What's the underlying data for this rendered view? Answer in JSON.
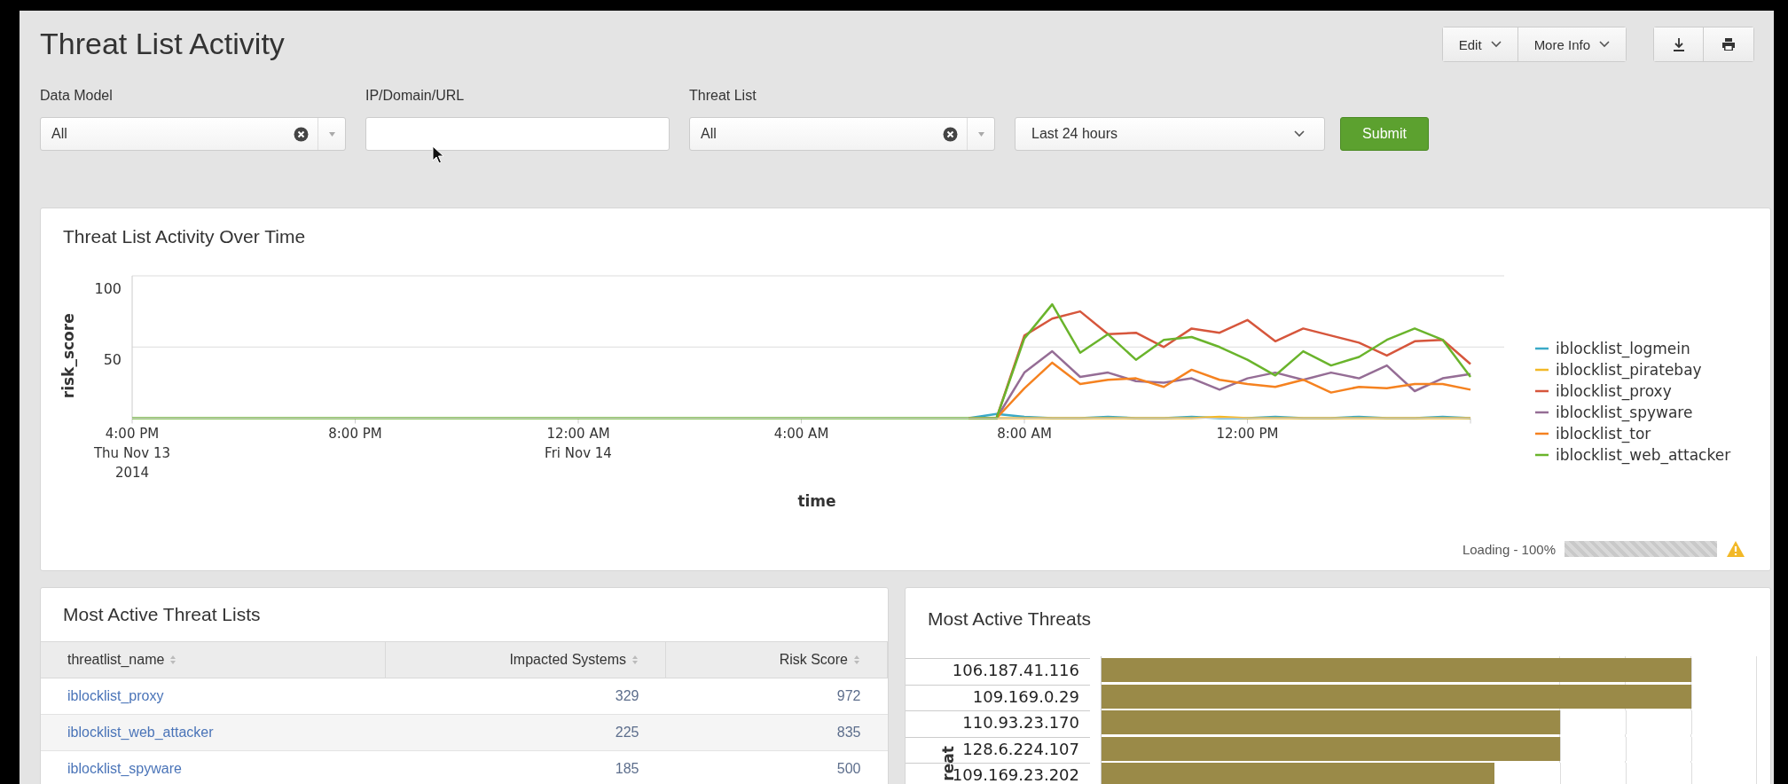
{
  "page": {
    "title": "Threat List Activity"
  },
  "toolbar": {
    "buttons": [
      {
        "label": "Edit",
        "kind": "menu"
      },
      {
        "label": "More Info",
        "kind": "menu"
      }
    ],
    "icon_buttons": [
      {
        "kind": "download"
      },
      {
        "kind": "print"
      }
    ]
  },
  "filters": [
    {
      "kind": "multiselect",
      "label": "Data Model",
      "value": "All"
    },
    {
      "kind": "text",
      "label": "IP/Domain/URL"
    },
    {
      "kind": "multiselect",
      "label": "Threat List",
      "value": "All"
    },
    {
      "kind": "dropdown",
      "value": "Last 24 hours"
    }
  ],
  "submit": {
    "label": "Submit"
  },
  "activity_panel": {
    "title": "Threat List Activity Over Time",
    "chart_data": {
      "type": "line",
      "xlabel": "time",
      "ylabel": "risk_score",
      "ylim": [
        0,
        100
      ],
      "yticks": [
        50,
        100
      ],
      "categories": [
        "4:00 PM\nThu Nov 13\n2014",
        null,
        null,
        null,
        null,
        null,
        null,
        null,
        "8:00 PM",
        null,
        null,
        null,
        null,
        null,
        null,
        null,
        "12:00 AM\nFri Nov 14",
        null,
        null,
        null,
        null,
        null,
        null,
        null,
        "4:00 AM",
        null,
        null,
        null,
        null,
        null,
        null,
        null,
        "8:00 AM",
        null,
        null,
        null,
        null,
        null,
        null,
        null,
        "12:00 PM",
        null,
        null,
        null,
        null,
        null,
        null,
        null,
        null
      ],
      "legend": "right",
      "series": [
        {
          "name": "iblocklist_logmein",
          "color": "#3aa9c7",
          "values": [
            null,
            null,
            null,
            null,
            null,
            null,
            null,
            null,
            null,
            null,
            null,
            null,
            null,
            null,
            null,
            null,
            null,
            null,
            null,
            null,
            null,
            null,
            null,
            null,
            null,
            null,
            null,
            null,
            null,
            null,
            0,
            3,
            1,
            0,
            0,
            1,
            0,
            0,
            1,
            0,
            0,
            1,
            0,
            0,
            1,
            0,
            0,
            1,
            0
          ]
        },
        {
          "name": "iblocklist_piratebay",
          "color": "#f2b827",
          "values": [
            null,
            null,
            null,
            null,
            null,
            null,
            null,
            null,
            null,
            null,
            null,
            null,
            null,
            null,
            null,
            null,
            null,
            null,
            null,
            null,
            null,
            null,
            null,
            null,
            null,
            null,
            null,
            null,
            null,
            null,
            0,
            0,
            0,
            0,
            0,
            0,
            0,
            0,
            0,
            1,
            0,
            0,
            0,
            0,
            0,
            0,
            0,
            0,
            0
          ]
        },
        {
          "name": "iblocklist_proxy",
          "color": "#d6563c",
          "values": [
            null,
            null,
            null,
            null,
            null,
            null,
            null,
            null,
            null,
            null,
            null,
            null,
            null,
            null,
            null,
            null,
            null,
            null,
            null,
            null,
            null,
            null,
            null,
            null,
            null,
            null,
            null,
            null,
            null,
            null,
            0,
            0,
            58,
            70,
            75,
            59,
            60,
            50,
            63,
            60,
            69,
            54,
            63,
            58,
            53,
            44,
            54,
            55,
            38
          ]
        },
        {
          "name": "iblocklist_spyware",
          "color": "#956d95",
          "values": [
            null,
            null,
            null,
            null,
            null,
            null,
            null,
            null,
            null,
            null,
            null,
            null,
            null,
            null,
            null,
            null,
            null,
            null,
            null,
            null,
            null,
            null,
            null,
            null,
            null,
            null,
            null,
            null,
            null,
            null,
            0,
            0,
            32,
            47,
            29,
            32,
            26,
            25,
            28,
            20,
            28,
            32,
            27,
            32,
            28,
            37,
            19,
            28,
            31
          ]
        },
        {
          "name": "iblocklist_tor",
          "color": "#f58220",
          "values": [
            null,
            null,
            null,
            null,
            null,
            null,
            null,
            null,
            null,
            null,
            null,
            null,
            null,
            null,
            null,
            null,
            null,
            null,
            null,
            null,
            null,
            null,
            null,
            null,
            null,
            null,
            null,
            null,
            null,
            null,
            0,
            0,
            21,
            39,
            24,
            27,
            28,
            22,
            34,
            27,
            24,
            22,
            27,
            18,
            22,
            21,
            24,
            24,
            20
          ]
        },
        {
          "name": "iblocklist_web_attacker",
          "color": "#6ab42c",
          "values": [
            0,
            0,
            0,
            0,
            0,
            0,
            0,
            0,
            0,
            0,
            0,
            0,
            0,
            0,
            0,
            0,
            0,
            0,
            0,
            0,
            0,
            0,
            0,
            0,
            0,
            0,
            0,
            0,
            0,
            0,
            0,
            0,
            56,
            80,
            46,
            59,
            41,
            55,
            57,
            50,
            41,
            30,
            47,
            37,
            43,
            55,
            63,
            55,
            29
          ]
        }
      ]
    },
    "status": {
      "text": "Loading - 100%",
      "level": 1,
      "warning": true
    }
  },
  "threat_lists_panel": {
    "title": "Most Active Threat Lists",
    "table": {
      "columns": [
        {
          "label": "threatlist_name",
          "kind": "text"
        },
        {
          "label": "Impacted Systems",
          "kind": "number"
        },
        {
          "label": "Risk Score",
          "kind": "number"
        }
      ],
      "rows": [
        [
          "iblocklist_proxy",
          "329",
          "972"
        ],
        [
          "iblocklist_web_attacker",
          "225",
          "835"
        ],
        [
          "iblocklist_spyware",
          "185",
          "500"
        ]
      ]
    }
  },
  "threats_panel": {
    "title": "Most Active Threats",
    "axis_label": "reat",
    "bars": [
      {
        "label": "106.187.41.116",
        "level": 0.9
      },
      {
        "label": "109.169.0.29",
        "level": 0.9
      },
      {
        "label": "110.93.23.170",
        "level": 0.7
      },
      {
        "label": "128.6.224.107",
        "level": 0.7
      },
      {
        "label": "109.169.23.202",
        "level": 0.6
      }
    ]
  }
}
